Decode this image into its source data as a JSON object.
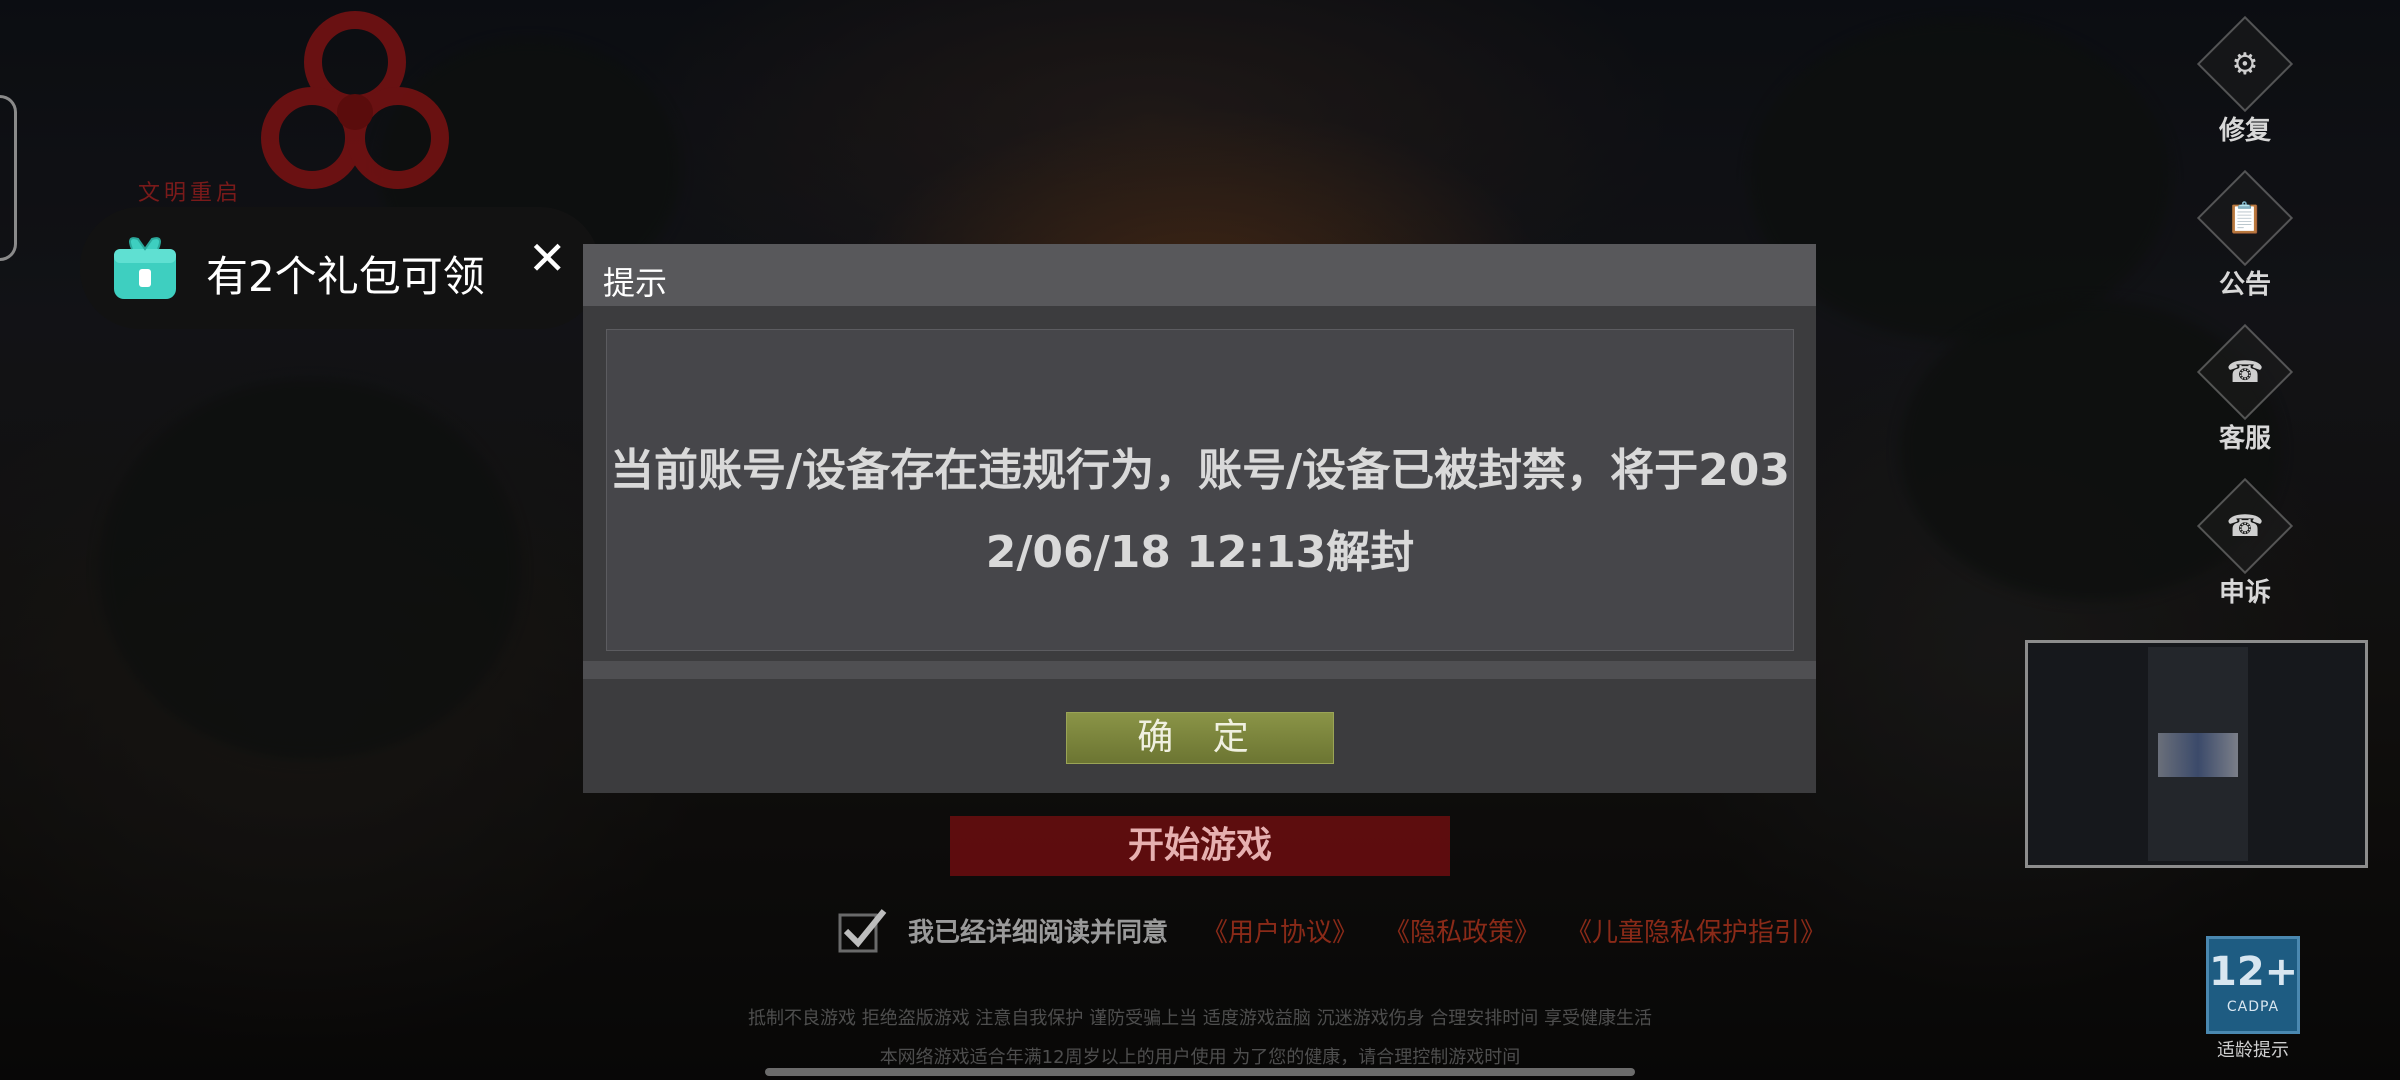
{
  "gift_toast": {
    "text": "有2个礼包可领",
    "close_symbol": "✕"
  },
  "logo": {
    "text": "文明重启"
  },
  "sidebar": [
    {
      "label": "修复",
      "icon": "gears-icon",
      "glyph": "⚙"
    },
    {
      "label": "公告",
      "icon": "announcement-icon",
      "glyph": "📋"
    },
    {
      "label": "客服",
      "icon": "headset-icon",
      "glyph": "☎"
    },
    {
      "label": "申诉",
      "icon": "appeal-headset-icon",
      "glyph": "☎"
    }
  ],
  "dialog": {
    "title": "提示",
    "message_line1": "当前账号/设备存在违规行为，账号/设备已被封禁，将于203",
    "message_line2": "2/06/18 12:13解封",
    "ok_label": "确 定"
  },
  "start_button": {
    "label": "开始游戏"
  },
  "agreement": {
    "text": "我已经详细阅读并同意",
    "links": [
      "《用户协议》",
      "《隐私政策》",
      "《儿童隐私保护指引》"
    ]
  },
  "notices": {
    "line1": "抵制不良游戏 拒绝盗版游戏 注意自我保护 谨防受骗上当 适度游戏益脑 沉迷游戏伤身 合理安排时间 享受健康生活",
    "line2": "本网络游戏适合年满12周岁以上的用户使用   为了您的健康，请合理控制游戏时间"
  },
  "age_badge": {
    "rating": "12+",
    "org": "CADPA",
    "caption": "适龄提示"
  },
  "colors": {
    "accent_start": "#7a0e10",
    "ok_button": "#7c8640",
    "gift_icon": "#3ecfc0"
  }
}
